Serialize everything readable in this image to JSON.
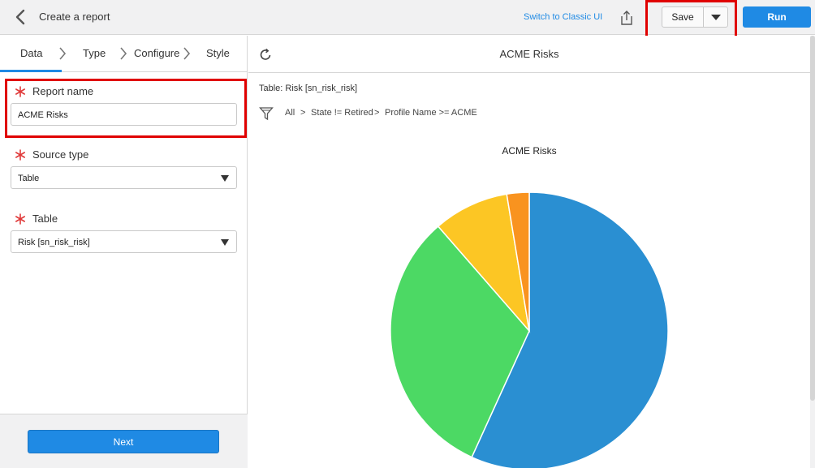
{
  "header": {
    "title": "Create a report",
    "switch_link": "Switch to Classic UI",
    "save_label": "Save",
    "run_label": "Run"
  },
  "tabs": [
    {
      "label": "Data",
      "active": true
    },
    {
      "label": "Type",
      "active": false
    },
    {
      "label": "Configure",
      "active": false
    },
    {
      "label": "Style",
      "active": false
    }
  ],
  "form": {
    "report_name": {
      "label": "Report name",
      "value": "ACME Risks",
      "required": true
    },
    "source_type": {
      "label": "Source type",
      "value": "Table",
      "required": true
    },
    "table": {
      "label": "Table",
      "value": "Risk [sn_risk_risk]",
      "required": true
    }
  },
  "footer": {
    "next_label": "Next"
  },
  "report": {
    "title": "ACME Risks",
    "table_label": "Table: Risk [sn_risk_risk]",
    "filter": [
      "All",
      "State != Retired",
      "Profile Name >= ACME"
    ],
    "filter_separator": ">"
  },
  "colors": {
    "accent": "#1f8ae4",
    "highlight": "#e00000",
    "required": "#e03a3a"
  },
  "chart_data": {
    "type": "pie",
    "title": "ACME Risks",
    "series": [
      {
        "value": 56.8,
        "color": "#2a8fd2"
      },
      {
        "value": 31.8,
        "color": "#4cd964"
      },
      {
        "value": 8.8,
        "color": "#fcc624"
      },
      {
        "value": 2.6,
        "color": "#f9931f"
      }
    ]
  }
}
